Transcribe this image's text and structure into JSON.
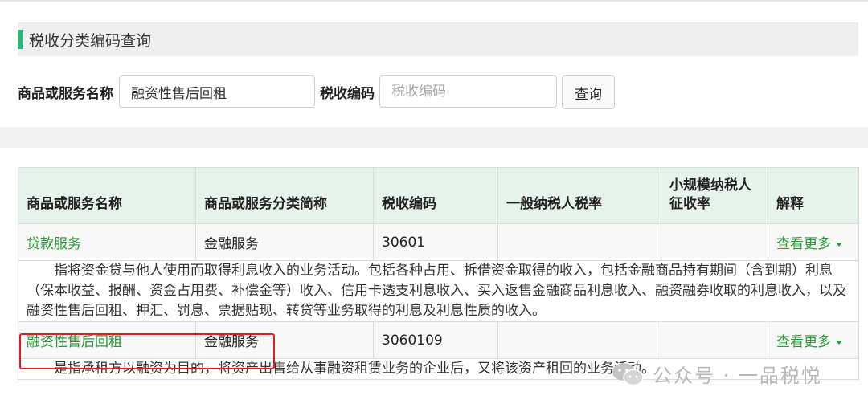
{
  "query_section": {
    "title": "税收分类编码查询",
    "name_label": "商品或服务名称",
    "name_value": "融资性售后回租",
    "code_label": "税收编码",
    "code_placeholder": "税收编码",
    "query_button": "查询",
    "accent_color": "#2bb673"
  },
  "results": {
    "columns": [
      "商品或服务名称",
      "商品或服务分类简称",
      "税收编码",
      "一般纳税人税率",
      "小规模纳税人征收率",
      "解释"
    ],
    "rows": [
      {
        "name": "贷款服务",
        "category": "金融服务",
        "code": "30601",
        "general_rate": "",
        "small_rate": "",
        "more": "查看更多",
        "description": "指将资金贷与他人使用而取得利息收入的业务活动。包括各种占用、拆借资金取得的收入，包括金融商品持有期间（含到期）利息（保本收益、报酬、资金占用费、补偿金等）收入、信用卡透支利息收入、买入返售金融商品利息收入、融资融券收取的利息收入，以及融资性售后回租、押汇、罚息、票据贴现、转贷等业务取得的利息及利息性质的收入。"
      },
      {
        "name": "融资性售后回租",
        "category": "金融服务",
        "code": "3060109",
        "general_rate": "",
        "small_rate": "",
        "more": "查看更多",
        "description": "是指承租方以融资为目的，将资产出售给从事融资租赁业务的企业后，又将该资产租回的业务活动。"
      }
    ],
    "link_color": "#2a9a36",
    "highlight_color": "#e02020"
  },
  "watermark": {
    "text": "公众号 · 一品税悦",
    "icon": "wechat-icon"
  }
}
